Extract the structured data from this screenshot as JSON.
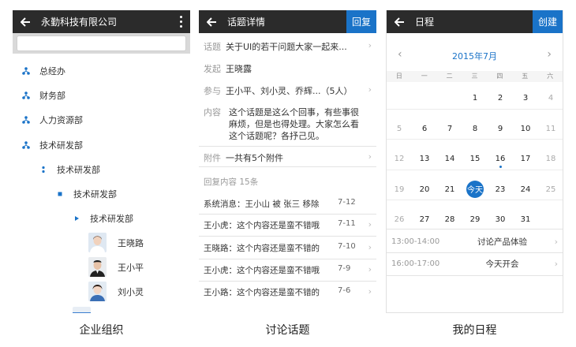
{
  "screen1": {
    "title": "永勤科技有限公司",
    "search_placeholder": "",
    "org": [
      {
        "label": "总经办"
      },
      {
        "label": "财务部"
      },
      {
        "label": "人力资源部"
      },
      {
        "label": "技术研发部"
      },
      {
        "label": "技术研发部"
      },
      {
        "label": "技术研发部"
      },
      {
        "label": "技术研发部"
      }
    ],
    "people": [
      {
        "name": "王晓路"
      },
      {
        "name": "王小平"
      },
      {
        "name": "刘小灵"
      }
    ],
    "caption": "企业组织"
  },
  "screen2": {
    "title": "话题详情",
    "action": "回复",
    "rows": [
      {
        "label": "话题",
        "value": "关于UI的若干问题大家一起来..."
      },
      {
        "label": "发起",
        "value": "王晓露"
      },
      {
        "label": "参与",
        "value": "王小平、刘小灵、乔辉...（5人）"
      },
      {
        "label": "内容",
        "value": "这个话题是这么个回事，有些事很麻烦，但是也得处理。大家怎么看这个话题呢？各抒己见。"
      },
      {
        "label": "附件",
        "value": "一共有5个附件"
      }
    ],
    "reply_count": "回复内容 15条",
    "replies": [
      {
        "text": "系统消息：王小山 被 张三 移除",
        "date": "7-12"
      },
      {
        "text": "王小虎：这个内容还是蛮不错哦",
        "date": "7-11"
      },
      {
        "text": "王晓路：这个内容还是蛮不错的",
        "date": "7-10"
      },
      {
        "text": "王小虎：这个内容还是蛮不错哦",
        "date": "7-9"
      },
      {
        "text": "王小路：这个内容还是蛮不错的",
        "date": "7-6"
      }
    ],
    "caption": "讨论话题"
  },
  "screen3": {
    "title": "日程",
    "action": "创建",
    "month": "2015年7月",
    "weekdays": [
      "日",
      "一",
      "二",
      "三",
      "四",
      "五",
      "六"
    ],
    "weeks": [
      [
        "",
        "",
        "",
        "1",
        "2",
        "3",
        "4"
      ],
      [
        "5",
        "6",
        "7",
        "8",
        "9",
        "10",
        "11"
      ],
      [
        "12",
        "13",
        "14",
        "15",
        "16",
        "17",
        "18"
      ],
      [
        "19",
        "20",
        "21",
        "今天",
        "23",
        "24",
        "25"
      ],
      [
        "26",
        "27",
        "28",
        "29",
        "30",
        "31",
        ""
      ]
    ],
    "events": [
      {
        "time": "13:00-14:00",
        "title": "讨论产品体验"
      },
      {
        "time": "16:00-17:00",
        "title": "今天开会"
      }
    ],
    "caption": "我的日程"
  }
}
